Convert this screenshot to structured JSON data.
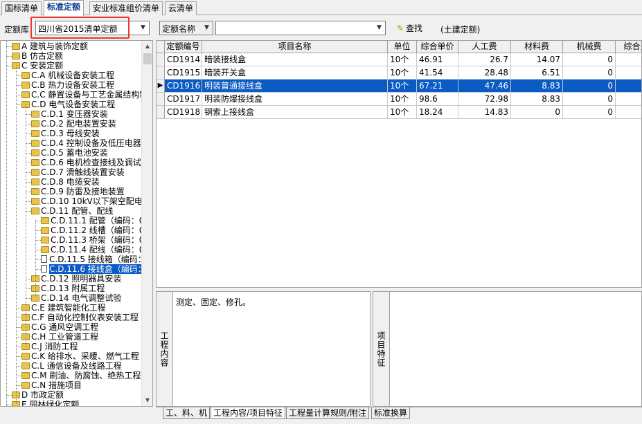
{
  "top_tabs": [
    {
      "label": "国标清单"
    },
    {
      "label": "标准定额"
    },
    {
      "label": "安业标准组价清单"
    },
    {
      "label": "云清单"
    }
  ],
  "toolbar": {
    "library_label": "定额库",
    "library_value": "四川省2015清单定额",
    "field_value": "定额名称",
    "search_placeholder": "",
    "search_value": "",
    "search_button": "查找",
    "scope_label": "(土建定额)"
  },
  "tree": {
    "items": [
      {
        "label": "A 建筑与装饰定额"
      },
      {
        "label": "B 仿古定额"
      },
      {
        "label": "C 安装定额"
      },
      {
        "label": "C.A 机械设备安装工程"
      },
      {
        "label": "C.B 热力设备安装工程"
      },
      {
        "label": "C.C 静置设备与工艺金属结构制"
      },
      {
        "label": "C.D 电气设备安装工程"
      },
      {
        "label": "C.D.1 变压器安装"
      },
      {
        "label": "C.D.2 配电装置安装"
      },
      {
        "label": "C.D.3 母线安装"
      },
      {
        "label": "C.D.4 控制设备及低压电器安"
      },
      {
        "label": "C.D.5 蓄电池安装"
      },
      {
        "label": "C.D.6 电机检查接线及调试"
      },
      {
        "label": "C.D.7 滑触线装置安装"
      },
      {
        "label": "C.D.8 电缆安装"
      },
      {
        "label": "C.D.9 防雷及接地装置"
      },
      {
        "label": "C.D.10 10kV以下架空配电线"
      },
      {
        "label": "C.D.11 配管、配线"
      },
      {
        "label": "C.D.11.1 配管（编码：0"
      },
      {
        "label": "C.D.11.2 线槽（编码：0"
      },
      {
        "label": "C.D.11.3 桥架（编码：0"
      },
      {
        "label": "C.D.11.4 配线（编码：0"
      },
      {
        "label": "C.D.11.5 接线箱（编码："
      },
      {
        "label": "C.D.11.6 接线盒（编码："
      },
      {
        "label": "C.D.12 照明器具安装"
      },
      {
        "label": "C.D.13 附属工程"
      },
      {
        "label": "C.D.14 电气调整试验"
      },
      {
        "label": "C.E 建筑智能化工程"
      },
      {
        "label": "C.F 自动化控制仪表安装工程"
      },
      {
        "label": "C.G 通风空调工程"
      },
      {
        "label": "C.H 工业管道工程"
      },
      {
        "label": "C.J 消防工程"
      },
      {
        "label": "C.K 给排水、采暖、燃气工程"
      },
      {
        "label": "C.L 通信设备及线路工程"
      },
      {
        "label": "C.M 刷油、防腐蚀、绝热工程"
      },
      {
        "label": "C.N 措施项目"
      },
      {
        "label": "D 市政定额"
      },
      {
        "label": "E 园林绿化定额"
      }
    ]
  },
  "grid": {
    "columns": [
      "定额编号",
      "项目名称",
      "单位",
      "综合单价",
      "人工费",
      "材料费",
      "机械费",
      "综合费"
    ],
    "rows": [
      [
        "CD1914",
        "暗装接线盒",
        "10个",
        "46.91",
        "26.7",
        "14.07",
        "0",
        "6"
      ],
      [
        "CD1915",
        "暗装开关盒",
        "10个",
        "41.54",
        "28.48",
        "6.51",
        "0",
        "6"
      ],
      [
        "CD1916",
        "明装普通接线盒",
        "10个",
        "67.21",
        "47.46",
        "8.83",
        "0",
        "10"
      ],
      [
        "CD1917",
        "明装防爆接线盒",
        "10个",
        "98.6",
        "72.98",
        "8.83",
        "0",
        "16"
      ],
      [
        "CD1918",
        "钢索上接线盒",
        "10个",
        "18.24",
        "14.83",
        "0",
        "0",
        "3"
      ]
    ],
    "selected_row_marker": "▶"
  },
  "panels": {
    "work_content_label": "工程内容",
    "work_content_text": "测定、固定、修孔。",
    "feature_label": "项目特征"
  },
  "bottom_tabs": [
    {
      "label": "工、料、机"
    },
    {
      "label": "工程内容/项目特征"
    },
    {
      "label": "工程量计算规则/附注"
    },
    {
      "label": "标准换算"
    }
  ],
  "colors": {
    "selection": "#0a5bc4",
    "highlight_box": "#e53935",
    "active_tab_text": "#0a3d91"
  }
}
